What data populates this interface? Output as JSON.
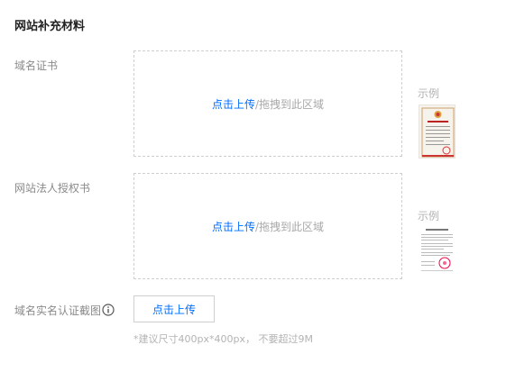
{
  "section": {
    "title": "网站补充材料"
  },
  "fields": [
    {
      "label": "域名证书",
      "upload_link": "点击上传",
      "drag_text": "/拖拽到此区域",
      "example_label": "示例"
    },
    {
      "label": "网站法人授权书",
      "upload_link": "点击上传",
      "drag_text": "/拖拽到此区域",
      "example_label": "示例"
    },
    {
      "label": "域名实名认证截图",
      "upload_button": "点击上传",
      "hint": "*建议尺寸400px*400px， 不要超过9M"
    }
  ],
  "colors": {
    "accent": "#006eff",
    "label": "#8a8a8a",
    "muted": "#b3b3b3",
    "border": "#cfcfcf"
  },
  "icons": {
    "info": "info-circle-icon"
  }
}
